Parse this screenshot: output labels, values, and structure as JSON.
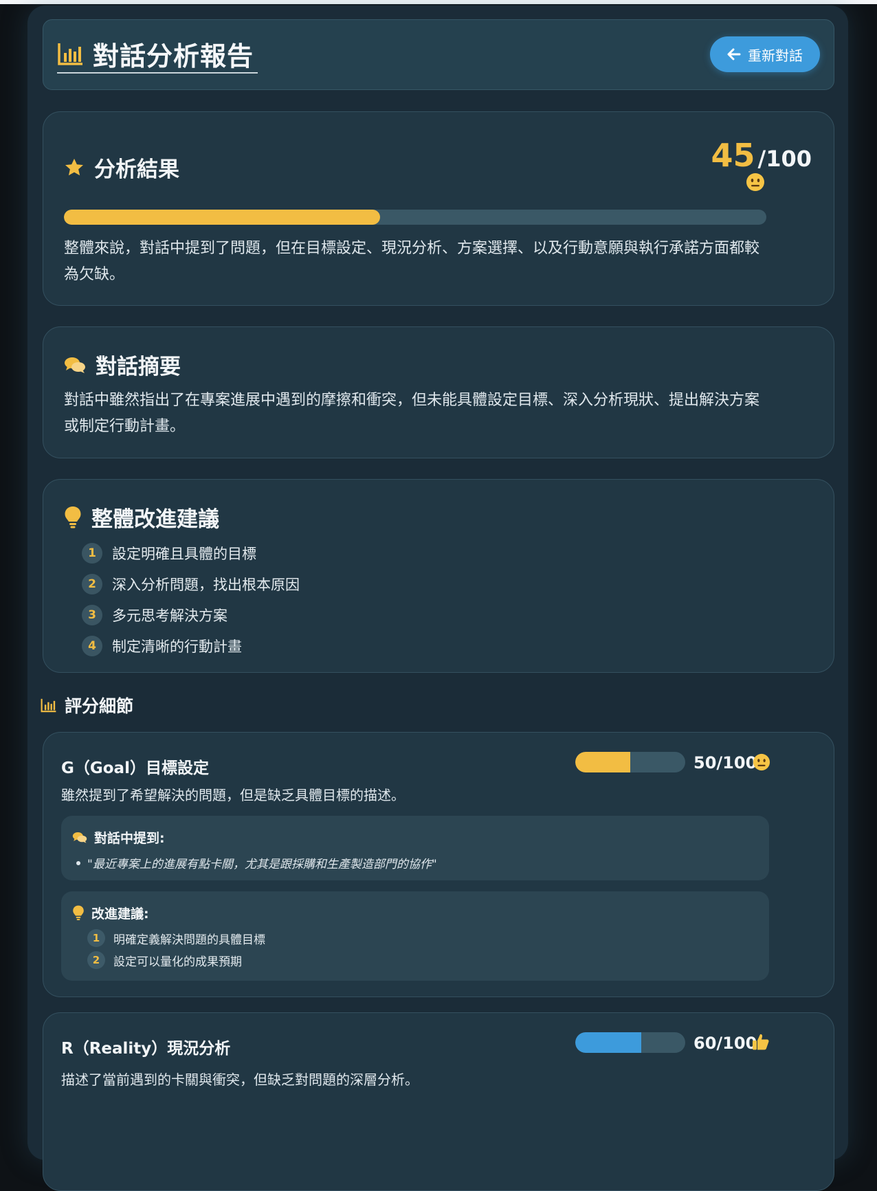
{
  "header": {
    "title": "對話分析報告",
    "title_icon": "chart-bar-icon",
    "restart_label": "重新對話",
    "restart_icon": "arrow-left-icon"
  },
  "result": {
    "heading": "分析結果",
    "heading_icon": "star-icon",
    "score": "45",
    "score_max": "/100",
    "score_progress_pct": 45,
    "mood_icon": "neutral-face-icon",
    "summary": "整體來說，對話中提到了問題，但在目標設定、現況分析、方案選擇、以及行動意願與執行承諾方面都較為欠缺。"
  },
  "conversation_summary": {
    "heading": "對話摘要",
    "heading_icon": "chat-bubbles-icon",
    "text": "對話中雖然指出了在專案進展中遇到的摩擦和衝突，但未能具體設定目標、深入分析現狀、提出解決方案或制定行動計畫。"
  },
  "improvements": {
    "heading": "整體改進建議",
    "heading_icon": "lightbulb-icon",
    "items": [
      {
        "num": "1",
        "text": "設定明確且具體的目標"
      },
      {
        "num": "2",
        "text": "深入分析問題，找出根本原因"
      },
      {
        "num": "3",
        "text": "多元思考解決方案"
      },
      {
        "num": "4",
        "text": "制定清晰的行動計畫"
      }
    ]
  },
  "score_details": {
    "heading": "評分細節",
    "heading_icon": "chart-bar-icon",
    "criteria": [
      {
        "title": "G（Goal）目標設定",
        "score": "50/100",
        "progress_pct": 50,
        "bar_color": "#f2bd43",
        "mood_icon": "neutral-face-icon",
        "description": "雖然提到了希望解決的問題，但是缺乏具體目標的描述。",
        "mentioned_heading": "對話中提到:",
        "quote": "\"最近專案上的進展有點卡關，尤其是跟採購和生產製造部門的協作\"",
        "suggest_heading": "改進建議:",
        "suggestions": [
          {
            "num": "1",
            "text": "明確定義解決問題的具體目標"
          },
          {
            "num": "2",
            "text": "設定可以量化的成果預期"
          }
        ]
      },
      {
        "title": "R（Reality）現況分析",
        "score": "60/100",
        "progress_pct": 60,
        "bar_color": "#3d9bdc",
        "mood_icon": "thumbs-up-icon",
        "description": "描述了當前遇到的卡關與衝突，但缺乏對問題的深層分析。"
      }
    ]
  },
  "colors": {
    "accent_yellow": "#f2bd43",
    "accent_blue": "#3d9bdc",
    "card_bg": "#213744",
    "app_bg": "#1b2c38"
  }
}
